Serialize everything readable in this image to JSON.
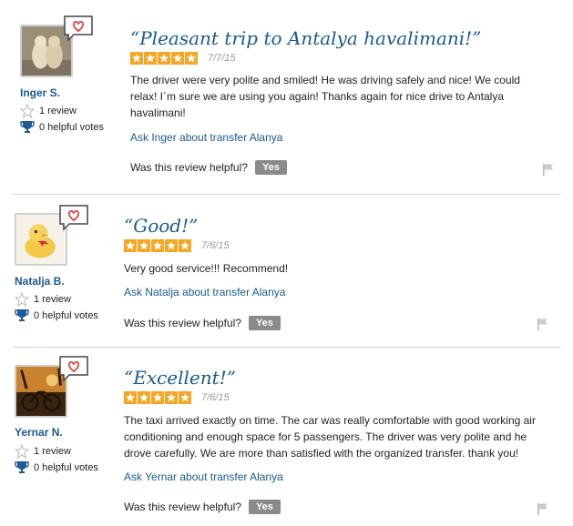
{
  "reviews": [
    {
      "user": "Inger S.",
      "review_count": "1 review",
      "helpful_votes": "0 helpful votes",
      "title": "“Pleasant trip to Antalya havalimani!”",
      "rating": 5,
      "date": "7/7/15",
      "body": "The driver were very polite and smiled! He was driving safely and nice! We could relax! I´m sure we are using you again! Thanks again for nice drive to Antalya havalimani!",
      "ask_link": "Ask Inger about transfer Alanya",
      "helpful_question": "Was this review helpful?",
      "yes_label": "Yes"
    },
    {
      "user": "Natalja B.",
      "review_count": "1 review",
      "helpful_votes": "0 helpful votes",
      "title": "“Good!”",
      "rating": 5,
      "date": "7/6/15",
      "body": "Very good service!!! Recommend!",
      "ask_link": "Ask Natalja about transfer Alanya",
      "helpful_question": "Was this review helpful?",
      "yes_label": "Yes"
    },
    {
      "user": "Yernar N.",
      "review_count": "1 review",
      "helpful_votes": "0 helpful votes",
      "title": "“Excellent!”",
      "rating": 5,
      "date": "7/6/15",
      "body": "The taxi arrived exactly on time. The car was really comfortable with good working air conditioning and enough space for 5 passengers. The driver was very polite and he drove carefully. We are more than satisfied with the organized transfer. thank you!",
      "ask_link": "Ask Yernar about transfer Alanya",
      "helpful_question": "Was this review helpful?",
      "yes_label": "Yes"
    }
  ],
  "colors": {
    "link": "#1a5a8e",
    "star": "#f5a623",
    "yes_button": "#8a8a8a",
    "heart": "#d9534f"
  }
}
